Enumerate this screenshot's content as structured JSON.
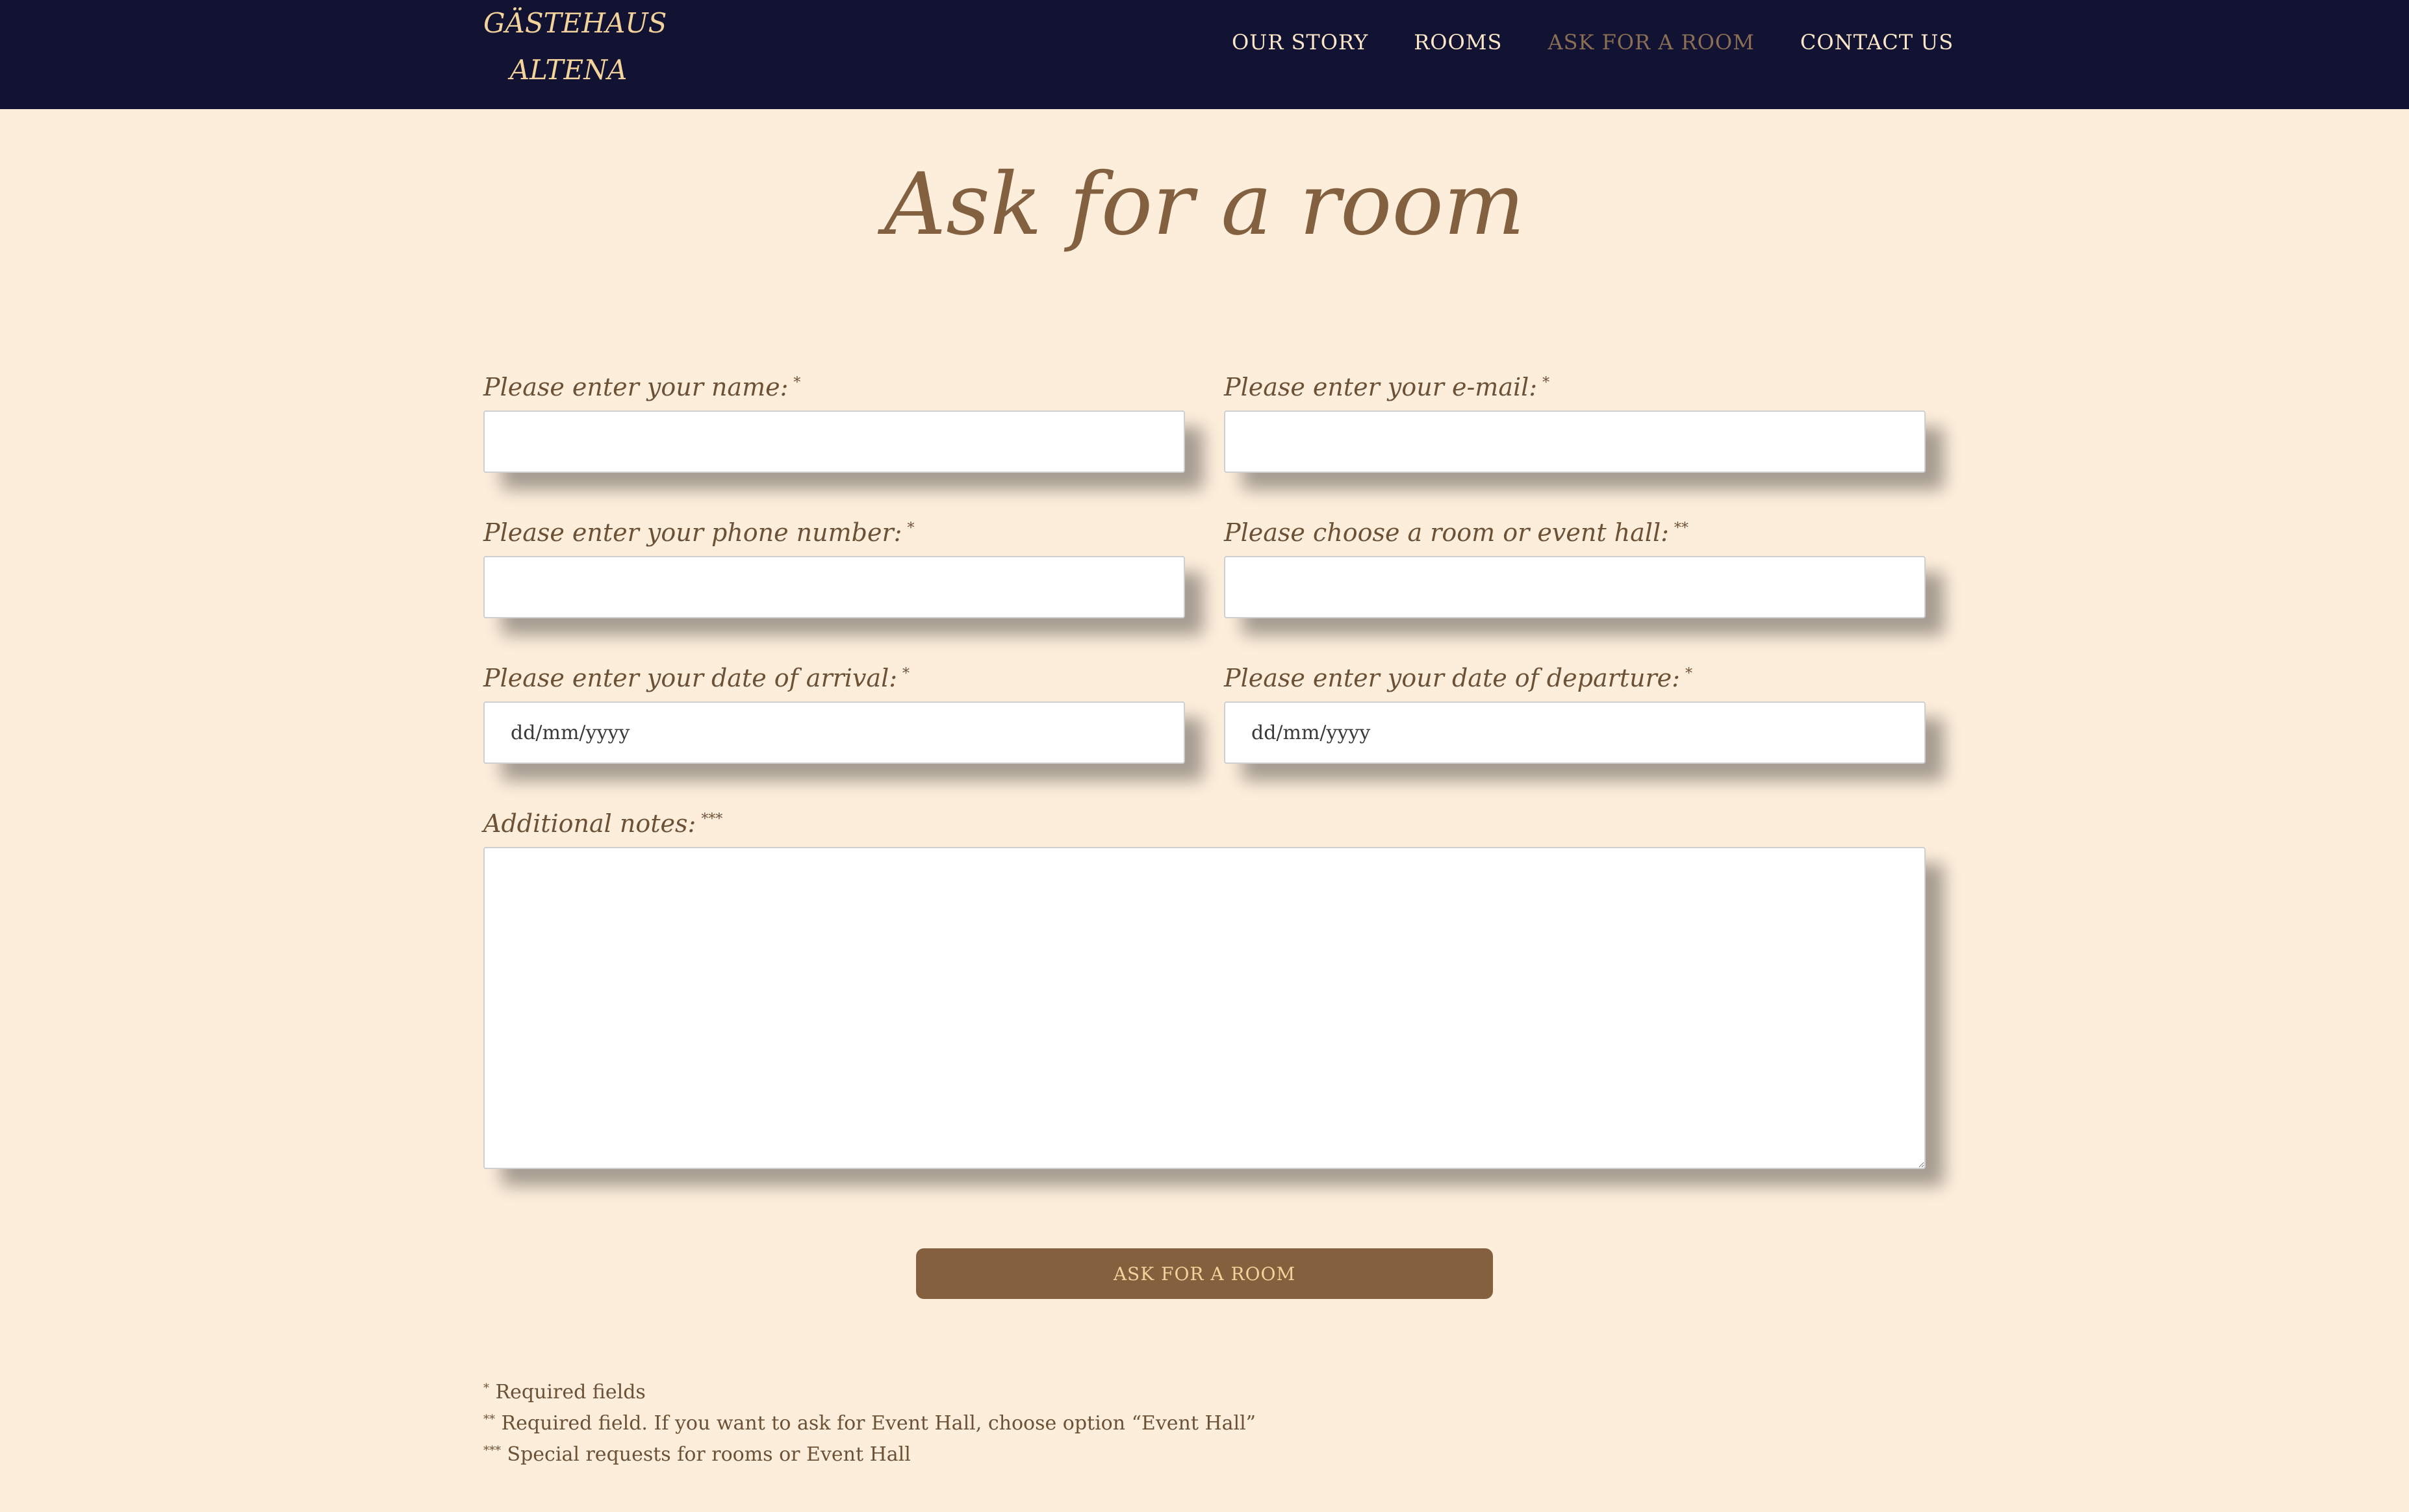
{
  "header": {
    "brand_line1": "GÄSTEHAUS",
    "brand_line2": "ALTENA",
    "nav": [
      {
        "label": "OUR STORY"
      },
      {
        "label": "ROOMS"
      },
      {
        "label": "ASK FOR A ROOM",
        "active": true
      },
      {
        "label": "CONTACT US"
      }
    ]
  },
  "main": {
    "title": "Ask for a room",
    "form": {
      "name_label": "Please enter your name:",
      "name_mark": "*",
      "email_label": "Please enter your e-mail:",
      "email_mark": "*",
      "phone_label": "Please enter your phone number:",
      "phone_mark": "*",
      "room_label": "Please choose a room or event hall:",
      "room_mark": "**",
      "arrival_label": "Please enter your date of arrival:",
      "arrival_mark": "*",
      "arrival_placeholder": "dd/mm/yyyy",
      "departure_label": "Please enter your date of departure:",
      "departure_mark": "*",
      "departure_placeholder": "dd/mm/yyyy",
      "notes_label": "Additional notes:",
      "notes_mark": "***",
      "submit_label": "ASK FOR A ROOM"
    },
    "footnotes": [
      {
        "mark": "*",
        "text": "Required fields"
      },
      {
        "mark": "**",
        "text": "Required field. If you want to ask for Event Hall, choose option “Event Hall”"
      },
      {
        "mark": "***",
        "text": "Special requests for rooms or Event Hall"
      }
    ]
  },
  "colors": {
    "background": "#fdeedc",
    "header": "#121233",
    "accent": "#84603f",
    "brand": "#f2d39b"
  }
}
